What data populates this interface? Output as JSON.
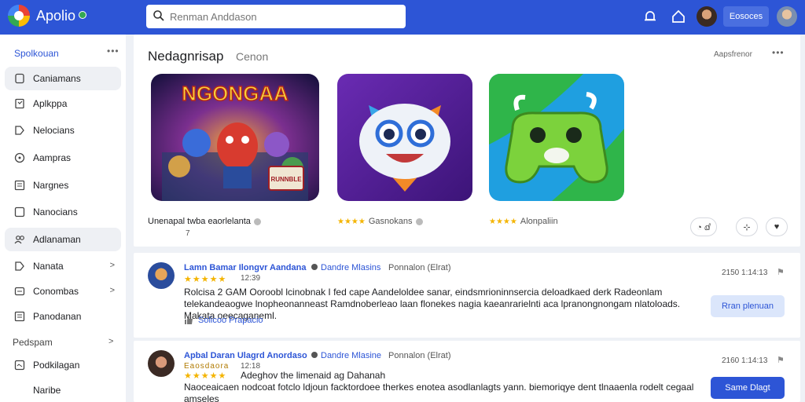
{
  "header": {
    "brand": "Apolio",
    "search_placeholder": "Renman Anddason",
    "action_button": "Eosoces"
  },
  "sidebar": {
    "heading": "Spolkouan",
    "more": "•••",
    "items": [
      {
        "label": "Caniamans",
        "icon": "document-icon"
      },
      {
        "label": "Aplkppa",
        "icon": "bookmark-icon"
      },
      {
        "label": "Nelocians",
        "icon": "tag-icon"
      },
      {
        "label": "Aampras",
        "icon": "clock-icon"
      },
      {
        "label": "Nargnes",
        "icon": "list-icon"
      },
      {
        "label": "Nanocians",
        "icon": "square-icon"
      },
      {
        "label": "Adlanaman",
        "icon": "people-icon"
      },
      {
        "label": "Nanata",
        "icon": "tag-icon"
      },
      {
        "label": "Conombas",
        "icon": "box-icon"
      },
      {
        "label": "Panodanan",
        "icon": "list-icon"
      }
    ],
    "section_label": "Pedspam",
    "section_items": [
      {
        "label": "Podkilagan",
        "icon": "folder-icon"
      },
      {
        "label": "Naribe",
        "icon": ""
      }
    ]
  },
  "featured": {
    "title": "Nedagnrisap",
    "subtitle": "Cenon",
    "link": "Aapsfrenor",
    "more": "•••",
    "apps": [
      {
        "art_text": "NGONGAA",
        "badge_text": "RUNNBLE",
        "caption": "Unenapal twba eaorlelanta",
        "sub": "7"
      },
      {
        "stars": "★★★★",
        "caption": "Gasnokans"
      },
      {
        "stars": "★★★★",
        "caption": "Alonpaliin"
      }
    ],
    "rating_buttons": [
      {
        "symbol": "◔ ⅆ",
        "icon": "reactions-icon"
      },
      {
        "symbol": "⊹",
        "icon": "add-icon"
      },
      {
        "symbol": "♥",
        "icon": "heart-icon"
      }
    ]
  },
  "reviews": [
    {
      "name": "Lamn Bamar Ilongvr Aandana",
      "name2": "Dandre Mlasins",
      "meta": "Ponnalon (Elrat)",
      "stars": "★★★★★",
      "time": "12:39",
      "date": "2150 1:14:13",
      "text": "Rolcisa 2 GAM Ooroobl lcinobnak I fed cape Aandeloldee sanar, eindsmrioninnsercia deloadkaed derk Radeonlam telekandeaogwe lnopheonanneast Ramdnoberleao laan flonekes nagia kaeanrarielnti aca lpranongnongam nlatoloads. Makata oeecaganeml.",
      "helpful": "Solicoo  Prapacio",
      "button": "Rran plenuan"
    },
    {
      "name": "Apbal Daran Ulagrd Anordaso",
      "name2": "Dandre Mlasine",
      "meta": "Ponnalon (Elrat)",
      "stars": "★★★★★",
      "time": "12:18",
      "stars_label": "Eaosdaora",
      "date": "2160 1:14:13",
      "title_line": "Adeghov the limenaid ag Dahanah",
      "text": "Naoceaicaen nodcoat fotclo ldjoun facktordoee therkes enotea asodlanlagts yann. biemoriqye dent tlnaaenla rodelt cegaal amseles",
      "button": "Same Dlagt"
    }
  ]
}
